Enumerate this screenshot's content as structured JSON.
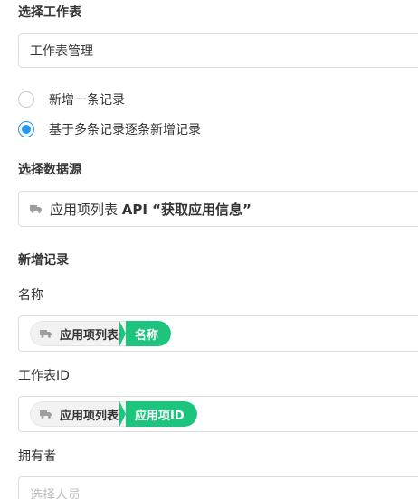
{
  "worksheet": {
    "section_title": "选择工作表",
    "selected_value": "工作表管理"
  },
  "mode": {
    "options": [
      {
        "label": "新增一条记录",
        "checked": false
      },
      {
        "label": "基于多条记录逐条新增记录",
        "checked": true
      }
    ]
  },
  "datasource": {
    "section_title": "选择数据源",
    "value_prefix": "应用项列表 ",
    "value_bold": "API “获取应用信息”"
  },
  "new_record": {
    "section_title": "新增记录",
    "fields": [
      {
        "label": "名称",
        "tag_source": "应用项列表",
        "tag_field": "名称"
      },
      {
        "label": "工作表ID",
        "tag_source": "应用项列表",
        "tag_field": "应用项ID"
      },
      {
        "label": "拥有者",
        "placeholder": "选择人员"
      }
    ]
  },
  "colors": {
    "accent_blue": "#2196f3",
    "tag_green": "#1cc47e"
  }
}
